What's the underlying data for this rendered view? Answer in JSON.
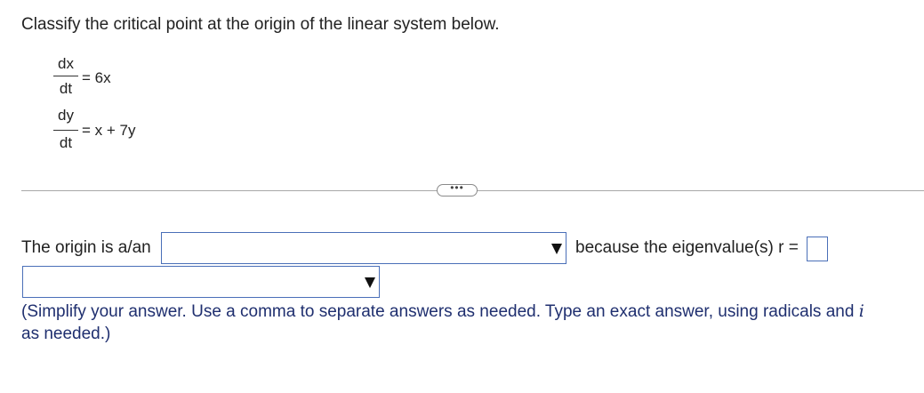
{
  "question": "Classify the critical point at the origin of the linear system below.",
  "system": {
    "eq1": {
      "numerator": "dx",
      "denominator": "dt",
      "rhs": "= 6x"
    },
    "eq2": {
      "numerator": "dy",
      "denominator": "dt",
      "rhs": "= x + 7y"
    }
  },
  "more_button_label": "•••",
  "answer": {
    "prefix": "The origin is a/an",
    "classification_value": "",
    "middle": "because the eigenvalue(s) r =",
    "eigenvalue_value": "",
    "second_dropdown_value": ""
  },
  "hint": {
    "text": "(Simplify your answer. Use a comma to separate answers as needed. Type an exact answer, using radicals and",
    "italic_var": "i",
    "tail": "as needed.)"
  },
  "colors": {
    "input_border": "#4a6fb8",
    "hint_text": "#1f2f6f",
    "divider": "#a8a8a8"
  }
}
